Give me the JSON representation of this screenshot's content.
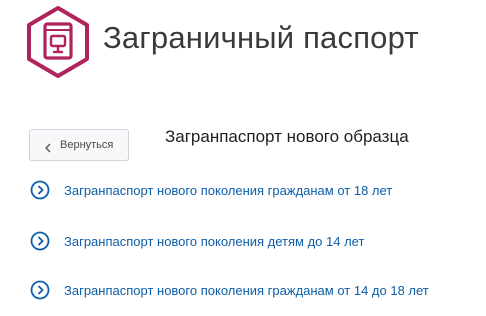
{
  "header": {
    "title": "Заграничный паспорт",
    "icon": "passport-icon"
  },
  "back_button": {
    "label": "Вернуться",
    "icon": "chevron-left-icon"
  },
  "section": {
    "title": "Загранпаспорт нового образца"
  },
  "links": [
    {
      "label": "Загранпаспорт нового поколения гражданам от 18 лет",
      "icon": "circle-chevron-right-icon"
    },
    {
      "label": "Загранпаспорт нового поколения детям до 14 лет",
      "icon": "circle-chevron-right-icon"
    },
    {
      "label": "Загранпаспорт нового поколения гражданам от 14 до 18 лет",
      "icon": "circle-chevron-right-icon"
    }
  ],
  "colors": {
    "brand": "#b0245e",
    "link": "#0d5ea8",
    "title": "#3a3a3a"
  }
}
